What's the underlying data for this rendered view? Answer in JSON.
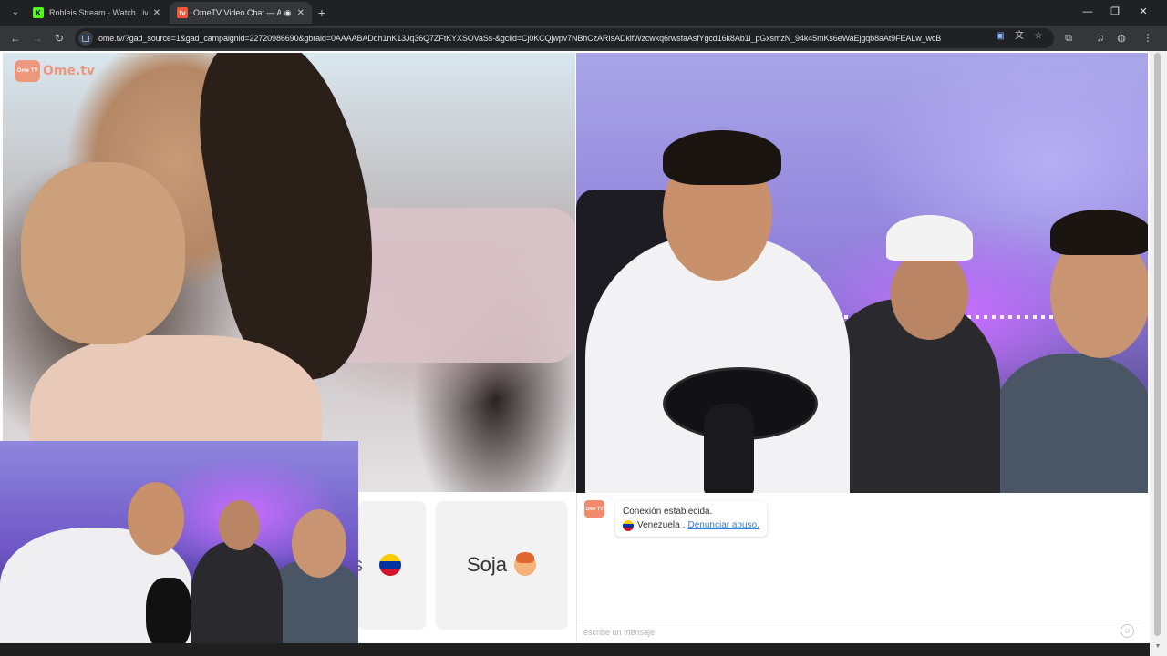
{
  "browser": {
    "tabs": [
      {
        "title": "Robleis Stream - Watch Live on",
        "favicon": "K",
        "favicon_color": "#53fc18",
        "active": false
      },
      {
        "title": "OmeTV Video Chat — Alte",
        "favicon": "tv",
        "favicon_color": "#f05a3a",
        "active": true
      }
    ],
    "url": "ome.tv/?gad_source=1&gad_campaignid=22720986690&gbraid=0AAAABADdh1nK13Jq36Q7ZFtKYXSOVaSs-&gclid=Cj0KCQjwpv7NBhCzARIsADklfWzcwkq6rwsfaAsfYgcd16k8Ab1l_pGxsmzN_94k45mKs6eWaEjgqb8aAt9FEALw_wcB",
    "icons": {
      "tab_menu": "chevron-down-icon",
      "new_tab": "plus-icon",
      "back": "arrow-left-icon",
      "forward": "arrow-right-icon",
      "reload": "reload-icon",
      "minimize": "minimize-icon",
      "restore": "restore-icon",
      "close": "close-icon"
    }
  },
  "site": {
    "logo_tv_text": "Ome TV",
    "logo_word": "Ome.tv",
    "brand_color": "#f28b6b"
  },
  "controls": {
    "left_button_peek": "s",
    "right_button_label": "Soja"
  },
  "chat": {
    "system_message_line1": "Conexión establecida.",
    "country": "Venezuela",
    "separator": ".",
    "report_link": "Denunciar abuso.",
    "input_placeholder": "escribe un mensaje",
    "emoji_icon": "smiley-icon",
    "flag_colors": [
      "#ffcc00",
      "#0033a0",
      "#cf142b"
    ]
  }
}
